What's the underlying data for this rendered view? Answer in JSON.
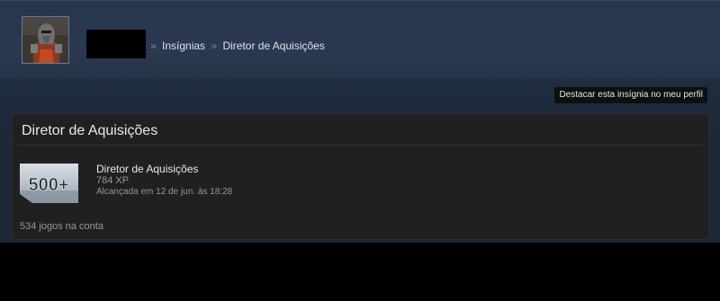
{
  "header": {
    "breadcrumb_separator": "»",
    "breadcrumb": [
      "Insígnias",
      "Diretor de Aquisições"
    ]
  },
  "actions": {
    "feature_badge_label": "Destacar esta insígnia no meu perfil"
  },
  "badge": {
    "panel_title": "Diretor de Aquisições",
    "icon_text": "500+",
    "name": "Diretor de Aquisições",
    "xp": "784 XP",
    "unlocked": "Alcançada em 12 de jun. às 18:28",
    "games_owned": "534 jogos na conta"
  }
}
